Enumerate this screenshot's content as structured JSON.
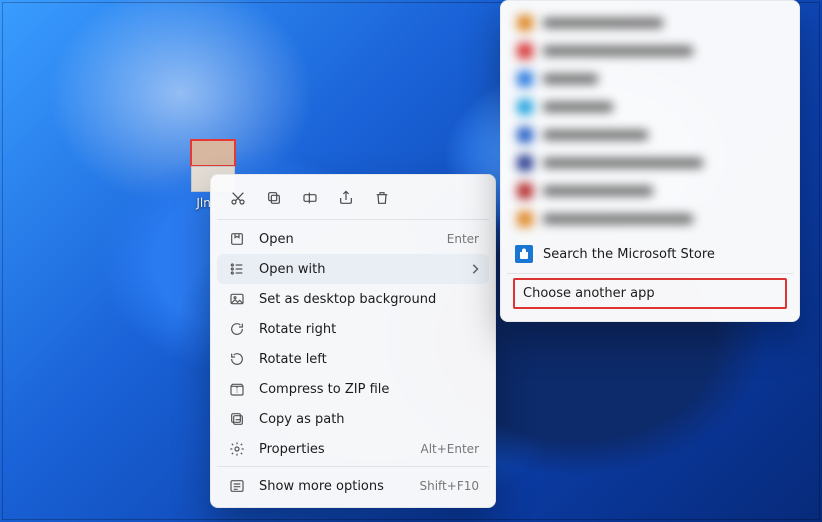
{
  "desktop": {
    "file_label": "Jln_ID"
  },
  "context_menu": {
    "actions": {
      "cut": "cut",
      "copy": "copy",
      "rename": "rename",
      "share": "share",
      "delete": "delete"
    },
    "items": [
      {
        "label": "Open",
        "hint": "Enter"
      },
      {
        "label": "Open with",
        "submenu": true
      },
      {
        "label": "Set as desktop background"
      },
      {
        "label": "Rotate right"
      },
      {
        "label": "Rotate left"
      },
      {
        "label": "Compress to ZIP file"
      },
      {
        "label": "Copy as path"
      },
      {
        "label": "Properties",
        "hint": "Alt+Enter"
      },
      {
        "label": "Show more options",
        "hint": "Shift+F10"
      }
    ]
  },
  "open_with_submenu": {
    "search_store": "Search the Microsoft Store",
    "choose_another": "Choose another app"
  }
}
